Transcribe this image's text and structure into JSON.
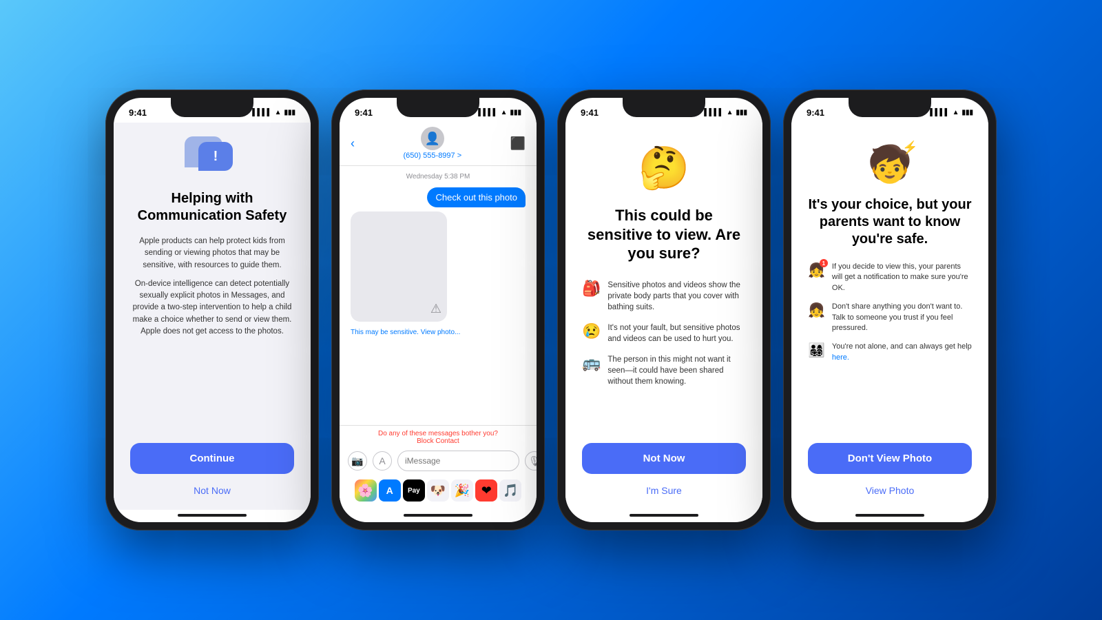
{
  "phones": [
    {
      "id": "phone1",
      "statusTime": "9:41",
      "title": "Helping with\nCommunication\nSafety",
      "body1": "Apple products can help protect kids from sending or viewing photos that may be sensitive, with resources to guide them.",
      "body2": "On-device intelligence can detect potentially sexually explicit photos in Messages, and provide a two-step intervention to help a child make a choice whether to send or view them. Apple does not get access to the photos.",
      "continueLabel": "Continue",
      "notNowLabel": "Not Now"
    },
    {
      "id": "phone2",
      "statusTime": "9:41",
      "contactName": "(650) 555-8997 >",
      "timestamp": "Wednesday 5:38 PM",
      "msgBubble": "Check out this photo",
      "sensitiveText": "This may be sensitive.",
      "viewPhotoText": "View photo...",
      "blockText": "Do any of these messages bother you?",
      "blockLink": "Block Contact",
      "inputPlaceholder": "iMessage"
    },
    {
      "id": "phone3",
      "statusTime": "9:41",
      "emoji": "🤔",
      "title": "This could be\nsensitive to view.\nAre you sure?",
      "reasons": [
        {
          "emoji": "🎒",
          "text": "Sensitive photos and videos show the private body parts that you cover with bathing suits."
        },
        {
          "emoji": "😢",
          "text": "It's not your fault, but sensitive photos and videos can be used to hurt you."
        },
        {
          "emoji": "🚌",
          "text": "The person in this might not want it seen—it could have been shared without them knowing."
        }
      ],
      "notNowLabel": "Not Now",
      "imSureLabel": "I'm Sure"
    },
    {
      "id": "phone4",
      "statusTime": "9:41",
      "emoji": "🧒",
      "title": "It's your choice, but\nyour parents want\nto know you're safe.",
      "infoItems": [
        {
          "emoji": "👧",
          "badge": "1",
          "text": "If you decide to view this, your parents will get a notification to make sure you're OK."
        },
        {
          "emoji": "👧",
          "text": "Don't share anything you don't want to. Talk to someone you trust if you feel pressured."
        },
        {
          "emoji": "👨‍👩‍👧‍👦",
          "text": "You're not alone, and can always get help here.",
          "hasLink": true,
          "linkText": "here"
        }
      ],
      "dontViewLabel": "Don't View Photo",
      "viewPhotoLabel": "View Photo"
    }
  ]
}
